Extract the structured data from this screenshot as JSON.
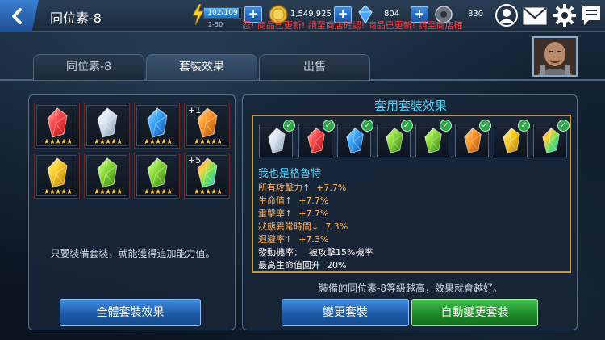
{
  "header": {
    "title": "同位素-8",
    "energy": {
      "value": "102/109",
      "fraction": 0.936,
      "timer": "2-50"
    },
    "coins": "1,549,925",
    "crystals": "804",
    "gear_points": "830",
    "ticker": "忍! 商品已更新! 請至商店確認! 商品已更新! 請至商店確"
  },
  "tabs": [
    {
      "label": "同位素-8",
      "active": false
    },
    {
      "label": "套裝效果",
      "active": true
    },
    {
      "label": "出售",
      "active": false
    }
  ],
  "left_panel": {
    "isotopes": [
      {
        "color": "red",
        "stars": "★★★★★",
        "level": ""
      },
      {
        "color": "white",
        "stars": "★★★★★",
        "level": ""
      },
      {
        "color": "blue",
        "stars": "★★★★★",
        "level": ""
      },
      {
        "color": "orange",
        "stars": "★★★★★",
        "level": "+1"
      },
      {
        "color": "yellow",
        "stars": "★★★★★",
        "level": ""
      },
      {
        "color": "green",
        "stars": "★★★★★",
        "level": ""
      },
      {
        "color": "green",
        "stars": "★★★★★",
        "level": ""
      },
      {
        "color": "rainbow",
        "stars": "★★★★★",
        "level": "+5"
      }
    ],
    "hint": "只要裝備套裝，就能獲得追加能力值。",
    "all_sets_button": "全體套裝效果"
  },
  "right_panel": {
    "title": "套用套裝效果",
    "equipped": [
      "white",
      "red",
      "blue",
      "green",
      "green",
      "orange",
      "yellow",
      "rainbow"
    ],
    "set_name": "我也是格魯特",
    "bonuses": [
      {
        "label": "所有攻擊力",
        "arrow": "↑",
        "value": "+7.7%"
      },
      {
        "label": "生命值",
        "arrow": "↑",
        "value": "+7.7%"
      },
      {
        "label": "重擊率",
        "arrow": "↑",
        "value": "+7.7%"
      },
      {
        "label": "狀態異常時間",
        "arrow": "↓",
        "value": "7.3%"
      },
      {
        "label": "迴避率",
        "arrow": "↑",
        "value": "+7.3%"
      }
    ],
    "special": [
      {
        "label": "發動機率：",
        "value": "被攻擊15%機率"
      },
      {
        "label": "最高生命值回升",
        "value": "20%"
      }
    ],
    "footer_note": "裝備的同位素-8等級越高，效果就會越好。",
    "change_button": "變更套裝",
    "auto_change_button": "自動變更套裝"
  },
  "colors": {
    "accent_cyan": "#4fd3ff",
    "bonus_orange": "#ffb35a",
    "ticker_red": "#ff3b3b",
    "gold_border": "#c89b2a"
  }
}
